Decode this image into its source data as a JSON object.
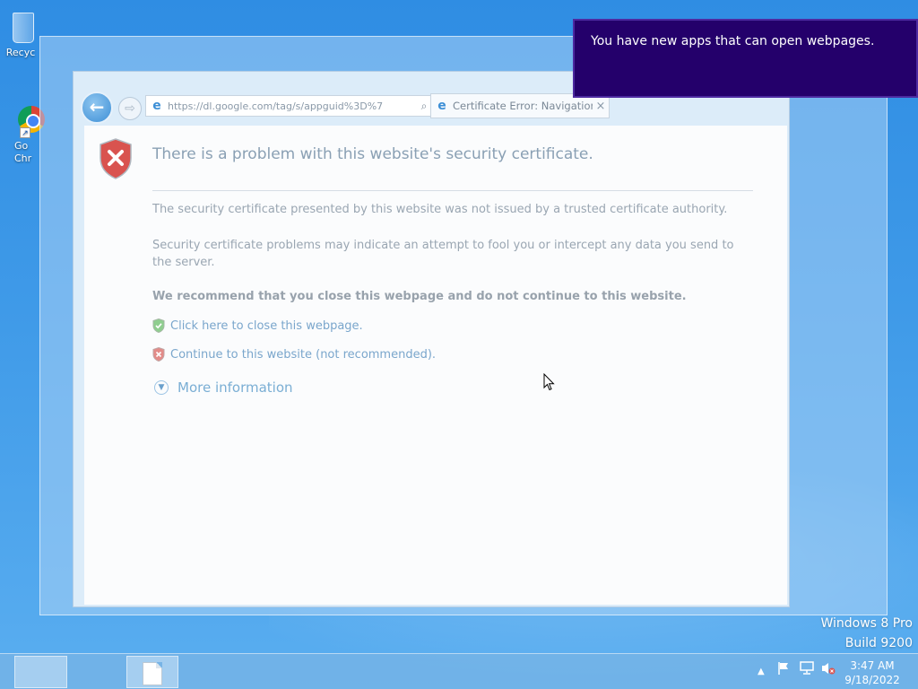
{
  "desktop": {
    "icons": [
      {
        "label": "Recyc",
        "icon": "recycle-bin-icon"
      },
      {
        "label": "Go\nChr",
        "icon": "chrome-icon"
      }
    ]
  },
  "browser": {
    "address_url": "https://dl.google.com/tag/s/appguid%3D%7",
    "tab_title": "Certificate Error: Navigation...",
    "tab_close": "×",
    "back_glyph": "←",
    "forward_glyph": "⇨",
    "search_glyph": "⌕",
    "dropdown_glyph": "▾",
    "refresh_glyph": "↻"
  },
  "page": {
    "title": "There is a problem with this website's security certificate.",
    "para1": "The security certificate presented by this website was not issued by a trusted certificate authority.",
    "para2": "Security certificate problems may indicate an attempt to fool you or intercept any data you send to the server.",
    "recommend": "We recommend that you close this webpage and do not continue to this website.",
    "link_close": "Click here to close this webpage.",
    "link_continue": "Continue to this website (not recommended).",
    "more_info": "More information"
  },
  "toast": {
    "message": "You have new apps that can open webpages."
  },
  "watermark": {
    "line1": "Windows 8 Pro",
    "line2": "Build 9200"
  },
  "taskbar": {
    "clock_time": "3:47 AM",
    "clock_date": "9/18/2022",
    "tray_chevron": "▲"
  },
  "colors": {
    "toast_bg": "#24006b",
    "desktop_blue": "#3f9ae8",
    "error_red": "#c9302c",
    "ok_green": "#5cb85c"
  }
}
